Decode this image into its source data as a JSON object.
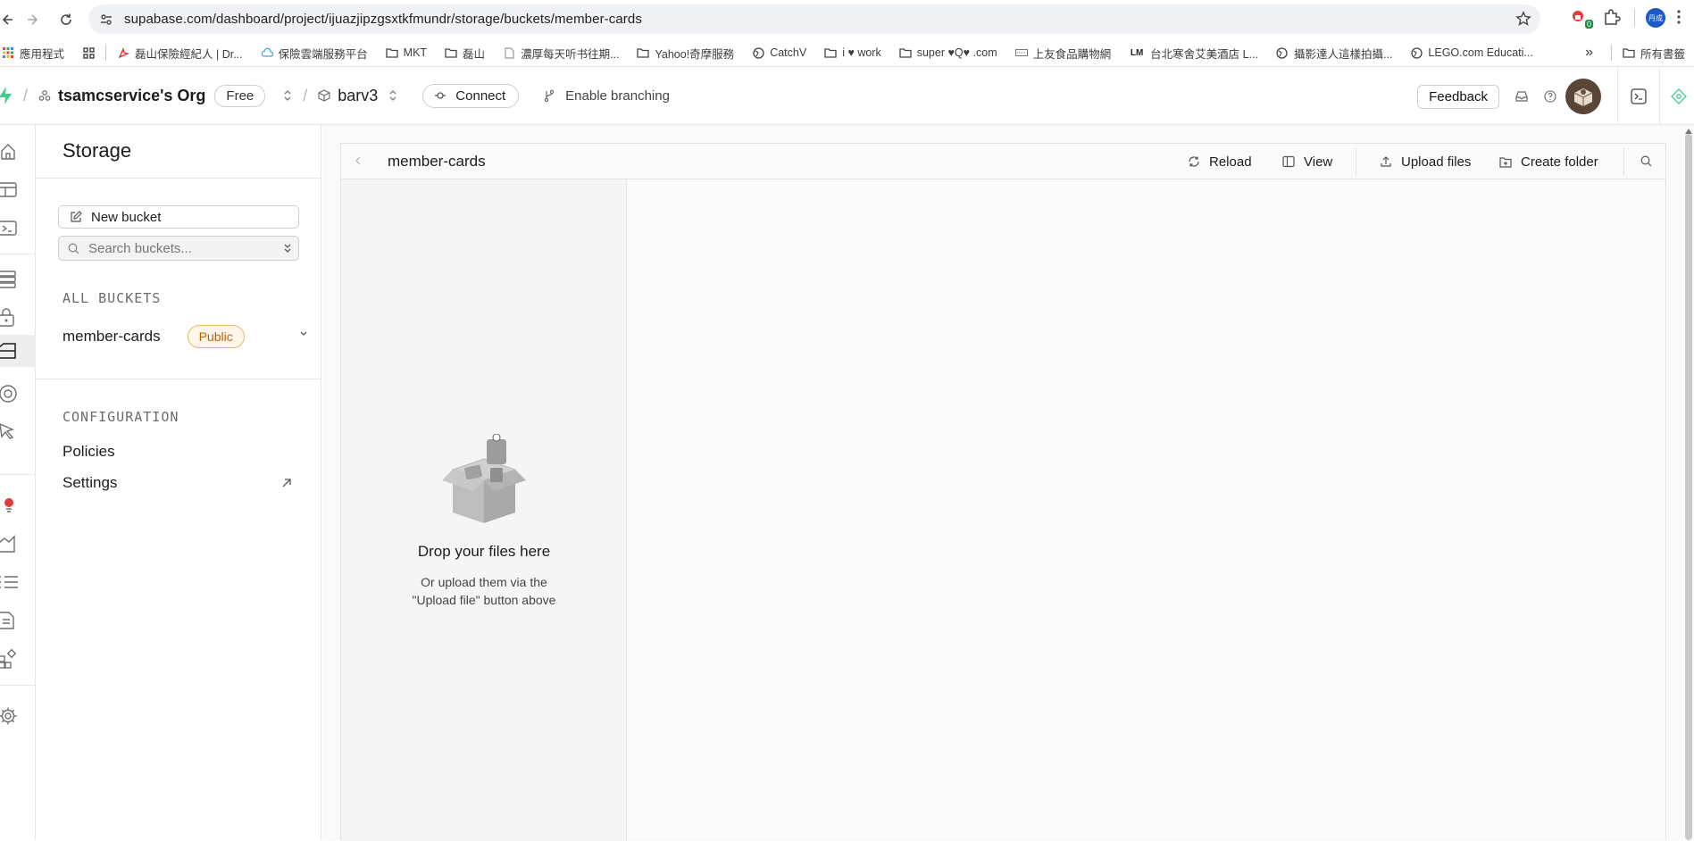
{
  "browser": {
    "url": "supabase.com/dashboard/project/ijuazjipzgsxtkfmundr/storage/buckets/member-cards",
    "bookmarks": [
      {
        "label": "應用程式",
        "icon": "apps-grid-icon"
      },
      {
        "label": "",
        "icon": "grid-icon"
      },
      {
        "label": "磊山保險經紀人 | Dr...",
        "icon": "pdf-icon"
      },
      {
        "label": "保險雲端服務平台",
        "icon": "cloud-icon"
      },
      {
        "label": "MKT",
        "icon": "folder-icon"
      },
      {
        "label": "磊山",
        "icon": "folder-icon"
      },
      {
        "label": "濃厚每天听书往期...",
        "icon": "page-icon"
      },
      {
        "label": "Yahoo!奇摩服務",
        "icon": "folder-icon"
      },
      {
        "label": "CatchV",
        "icon": "globe-icon"
      },
      {
        "label": "i ♥ work",
        "icon": "folder-icon"
      },
      {
        "label": "super ♥Q♥ .com",
        "icon": "folder-icon"
      },
      {
        "label": "上友食品購物網",
        "icon": "site-icon"
      },
      {
        "label": "台北寒舍艾美酒店 L...",
        "icon": "lm-icon"
      },
      {
        "label": "攝影達人這樣拍攝...",
        "icon": "globe-icon"
      },
      {
        "label": "LEGO.com Educati...",
        "icon": "globe-icon"
      }
    ],
    "bookmarks_more": "»",
    "all_bookmarks": "所有書籤",
    "ext_badge": "0",
    "profile_initials": "丹成"
  },
  "header": {
    "org": "tsamcservice's Org",
    "plan": "Free",
    "project": "barv3",
    "connect": "Connect",
    "branching": "Enable branching",
    "feedback": "Feedback"
  },
  "sidebar": {
    "title": "Storage",
    "new_bucket": "New bucket",
    "search_placeholder": "Search buckets...",
    "all_buckets_label": "ALL BUCKETS",
    "buckets": [
      {
        "name": "member-cards",
        "badge": "Public"
      }
    ],
    "configuration_label": "CONFIGURATION",
    "config_links": [
      "Policies",
      "Settings"
    ]
  },
  "explorer": {
    "breadcrumb": "member-cards",
    "toolbar": {
      "reload": "Reload",
      "view": "View",
      "upload": "Upload files",
      "create_folder": "Create folder"
    },
    "empty_title": "Drop your files here",
    "empty_line1": "Or upload them via the",
    "empty_line2": "\"Upload file\" button above"
  },
  "colors": {
    "public_badge_text": "#c45f00",
    "public_badge_border": "#f0b36a",
    "brand_green": "#3ecf8e"
  }
}
